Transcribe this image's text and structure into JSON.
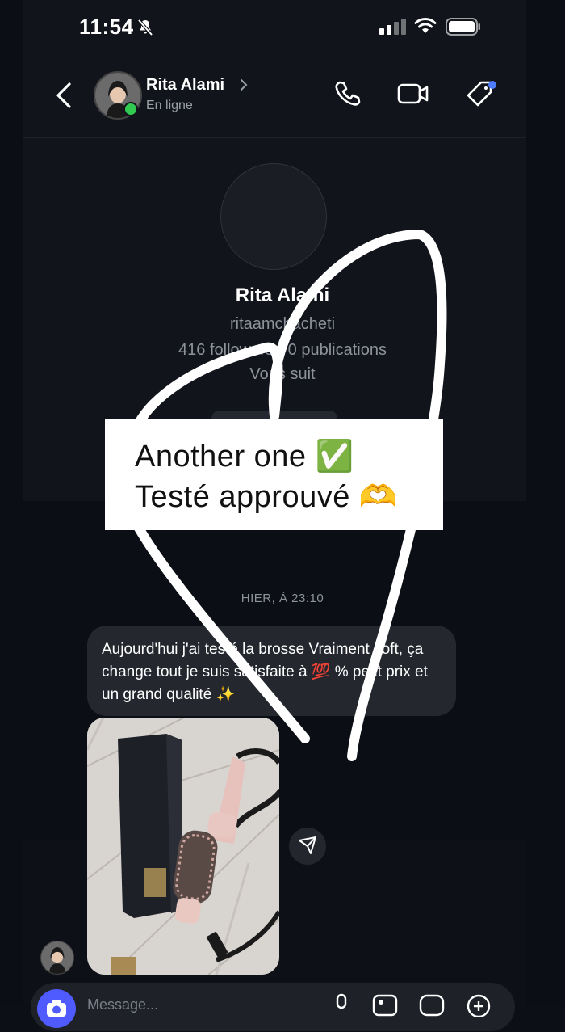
{
  "status_bar": {
    "time": "11:54"
  },
  "header": {
    "contact_name": "Rita Alami",
    "contact_status": "En ligne"
  },
  "profile": {
    "name": "Rita Alami",
    "handle": "ritaamchacheti",
    "stats": "416 followers · 0 publications",
    "follow_status": "Vous suit"
  },
  "sticker": {
    "line1": "Another one ✅",
    "line2": "Testé approuvé 🫶"
  },
  "chat": {
    "timestamp": "HIER, À 23:10",
    "message": "Aujourd'hui j'ai testé la brosse Vraiment soft, ça change tout je suis satisfaite à 💯 % petit prix et un grand qualité ✨"
  },
  "composer": {
    "placeholder": "Message..."
  },
  "colors": {
    "online": "#31c94f",
    "camera_button": "#4f5bff",
    "notification_dot": "#4d7cff"
  }
}
